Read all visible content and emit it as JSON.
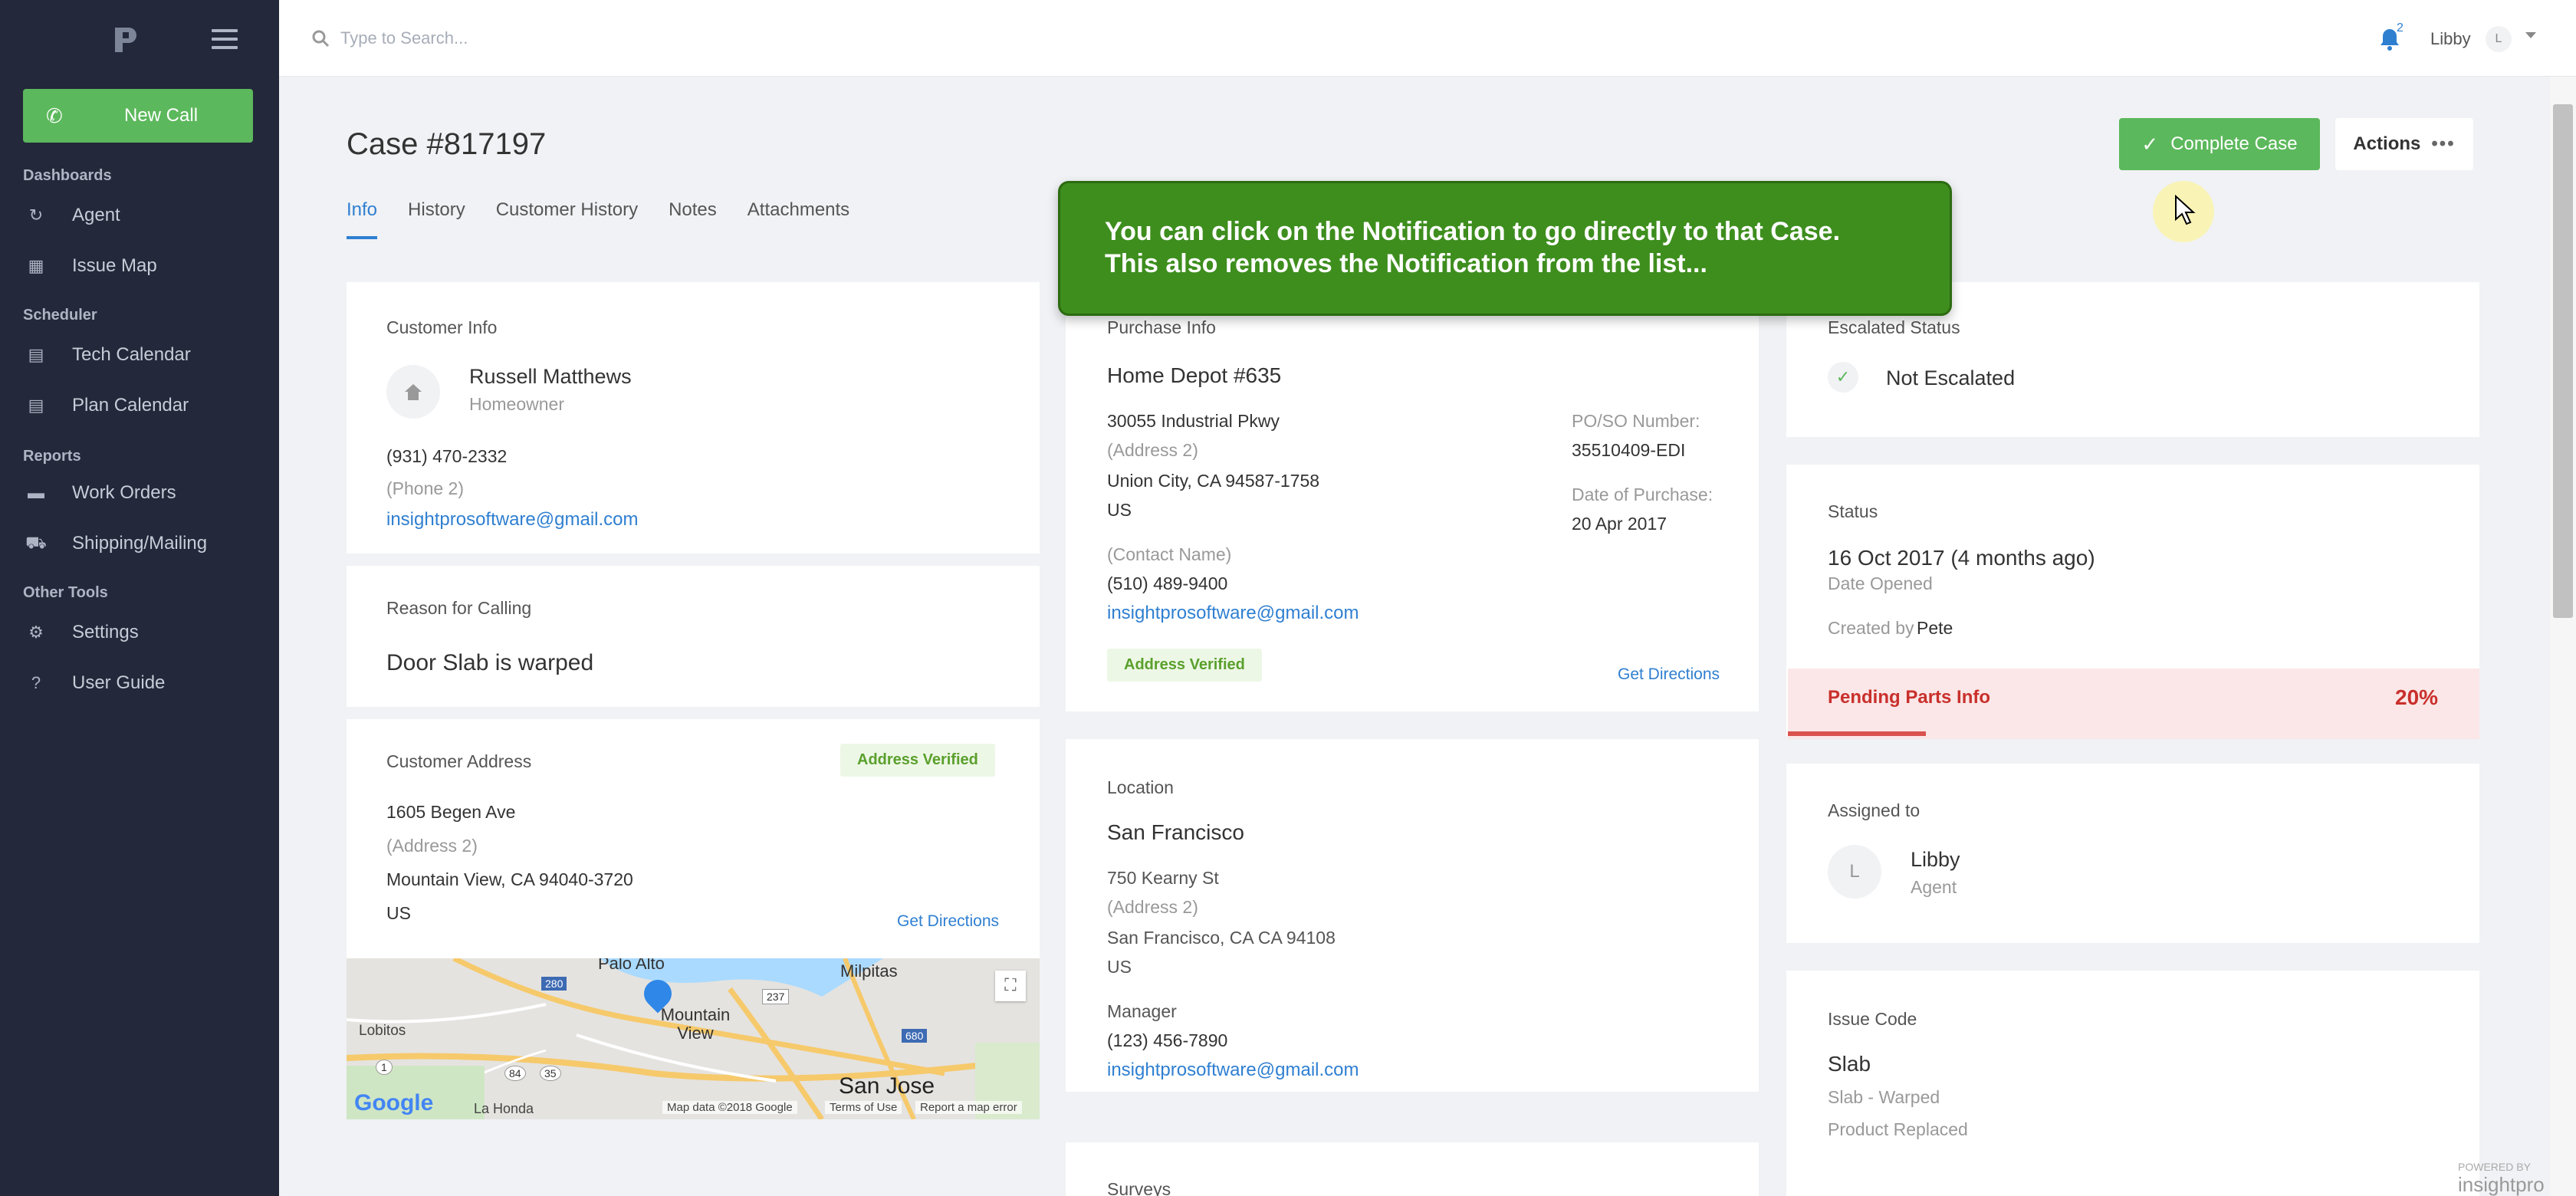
{
  "sidebar": {
    "new_call": "New Call",
    "groups": {
      "dashboards": "Dashboards",
      "scheduler": "Scheduler",
      "reports": "Reports",
      "other": "Other Tools"
    },
    "items": {
      "agent": "Agent",
      "issue_map": "Issue Map",
      "tech_calendar": "Tech Calendar",
      "plan_calendar": "Plan Calendar",
      "work_orders": "Work Orders",
      "shipping": "Shipping/Mailing",
      "settings": "Settings",
      "user_guide": "User Guide"
    }
  },
  "topbar": {
    "search_placeholder": "Type to Search...",
    "notification_count": "2",
    "user_name": "Libby",
    "user_initial": "L"
  },
  "case": {
    "title": "Case #817197",
    "complete_label": "Complete Case",
    "actions_label": "Actions",
    "tabs": [
      "Info",
      "History",
      "Customer History",
      "Notes",
      "Attachments"
    ]
  },
  "tooltip": {
    "line1": "You can click on the Notification to go directly to that Case.",
    "line2": "This also removes the Notification from the list..."
  },
  "customer_info": {
    "heading": "Customer Info",
    "name": "Russell Matthews",
    "role": "Homeowner",
    "phone": "(931) 470-2332",
    "phone2": "(Phone 2)",
    "email": "insightprosoftware@gmail.com"
  },
  "reason": {
    "heading": "Reason for Calling",
    "value": "Door Slab is warped"
  },
  "customer_address": {
    "heading": "Customer Address",
    "verified": "Address Verified",
    "line1": "1605 Begen Ave",
    "line2": "(Address 2)",
    "city": "Mountain View, CA 94040-3720",
    "country": "US",
    "directions": "Get Directions"
  },
  "map": {
    "labels": {
      "palo_alto": "Palo Alto",
      "milpitas": "Milpitas",
      "mountain_view": "Mountain View",
      "lobitos": "Lobitos",
      "san_jose": "San Jose",
      "la_honda": "La Honda",
      "google": "Google",
      "map_data": "Map data ©2018 Google",
      "terms": "Terms of Use",
      "report": "Report a map error",
      "r280": "280",
      "r237": "237",
      "r680": "680",
      "r84": "84",
      "r35": "35",
      "r1": "1"
    }
  },
  "purchase": {
    "heading": "Purchase Info",
    "store": "Home Depot #635",
    "line1": "30055 Industrial Pkwy",
    "line2": "(Address 2)",
    "city": "Union City, CA 94587-1758",
    "country": "US",
    "contact": "(Contact Name)",
    "phone": "(510) 489-9400",
    "email": "insightprosoftware@gmail.com",
    "po_label": "PO/SO Number:",
    "po_value": "35510409-EDI",
    "date_label": "Date of Purchase:",
    "date_value": "20 Apr 2017",
    "verified": "Address Verified",
    "directions": "Get Directions"
  },
  "location": {
    "heading": "Location",
    "name": "San Francisco",
    "line1": "750 Kearny St",
    "line2": "(Address 2)",
    "city": "San Francisco, CA CA 94108",
    "country": "US",
    "manager_label": "Manager",
    "manager_phone": "(123) 456-7890",
    "manager_email": "insightprosoftware@gmail.com"
  },
  "surveys": {
    "heading": "Surveys"
  },
  "escalated": {
    "heading": "Escalated Status",
    "value": "Not Escalated"
  },
  "status": {
    "heading": "Status",
    "date": "16 Oct 2017 (4 months ago)",
    "date_label": "Date Opened",
    "created_prefix": "Created by",
    "created_by": "Pete",
    "pending_label": "Pending Parts Info",
    "pending_percent": "20%",
    "progress_fraction": 0.2
  },
  "assigned": {
    "heading": "Assigned to",
    "initial": "L",
    "name": "Libby",
    "role": "Agent"
  },
  "issue_code": {
    "heading": "Issue Code",
    "value": "Slab",
    "sub1": "Slab - Warped",
    "sub2": "Product Replaced"
  },
  "branding": {
    "powered_by": "POWERED BY",
    "brand": "insightpro"
  },
  "colors": {
    "sidebar": "#23283a",
    "accent": "#2f7fd1",
    "success": "#5cb85c",
    "danger": "#d9534f",
    "tooltip": "#3e8e1e"
  }
}
